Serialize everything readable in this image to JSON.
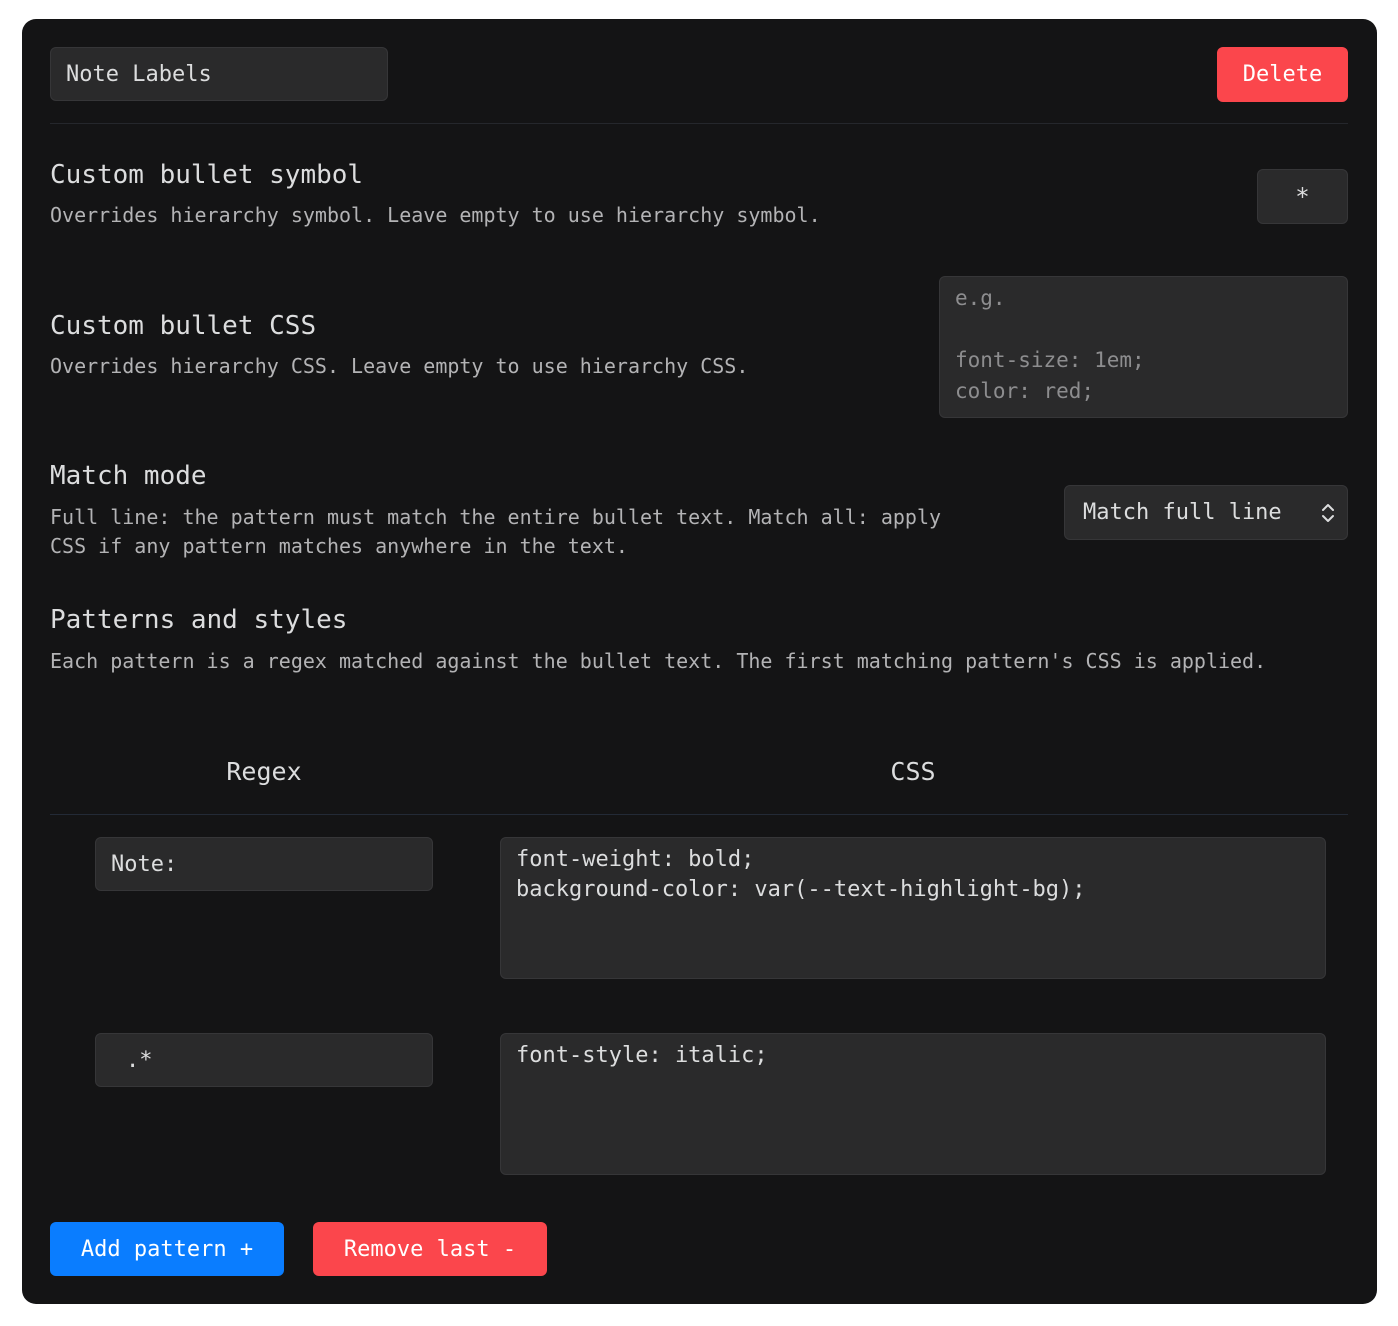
{
  "header": {
    "name_value": "Note Labels",
    "delete_label": "Delete"
  },
  "bullet_symbol": {
    "name": "Custom bullet symbol",
    "desc": "Overrides hierarchy symbol. Leave empty to use hierarchy symbol.",
    "value": "*"
  },
  "bullet_css": {
    "name": "Custom bullet CSS",
    "desc": "Overrides hierarchy CSS. Leave empty to use hierarchy CSS.",
    "placeholder": "e.g.\n\nfont-size: 1em;\ncolor: red;"
  },
  "match_mode": {
    "name": "Match mode",
    "desc": "Full line: the pattern must match the entire bullet text. Match all: apply CSS if any pattern matches anywhere in the text.",
    "selected": "Match full line",
    "chevron_icon": "chevron-up-down-icon"
  },
  "patterns": {
    "name": "Patterns and styles",
    "desc": "Each pattern is a regex matched against the bullet text. The first matching pattern's CSS is applied.",
    "columns": [
      "Regex",
      "CSS"
    ],
    "rows": [
      {
        "regex": "Note:",
        "css": "font-weight: bold;\nbackground-color: var(--text-highlight-bg);"
      },
      {
        "regex": ".*",
        "css": "font-style: italic;"
      }
    ]
  },
  "actions": {
    "add_label": "Add pattern +",
    "remove_label": "Remove last -"
  },
  "colors": {
    "accent_red": "#fb464c",
    "accent_blue": "#0a7dff",
    "panel_bg": "#141415",
    "input_bg": "#2a2a2b"
  }
}
